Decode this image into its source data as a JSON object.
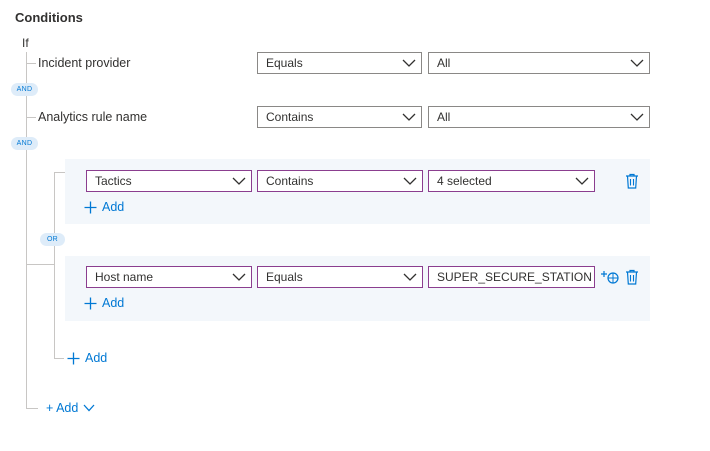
{
  "section_title": "Conditions",
  "if_label": "If",
  "conditions": [
    {
      "label": "Incident provider",
      "operator": "Equals",
      "value": "All"
    },
    {
      "label": "Analytics rule name",
      "operator": "Contains",
      "value": "All"
    }
  ],
  "connectors": {
    "and_1": "AND",
    "and_2": "AND",
    "or": "OR"
  },
  "groups": [
    {
      "property": "Tactics",
      "operator": "Contains",
      "value": "4 selected",
      "add_label": "Add"
    },
    {
      "property": "Host name",
      "operator": "Equals",
      "value": "SUPER_SECURE_STATION",
      "add_label": "Add"
    }
  ],
  "group_add_label": "Add",
  "bottom_add_label": "+ Add",
  "colors": {
    "accent": "#0078d4",
    "focus_border": "#8b3e8f",
    "group_bg": "#f3f7fb",
    "pill_bg": "#deecf9"
  }
}
